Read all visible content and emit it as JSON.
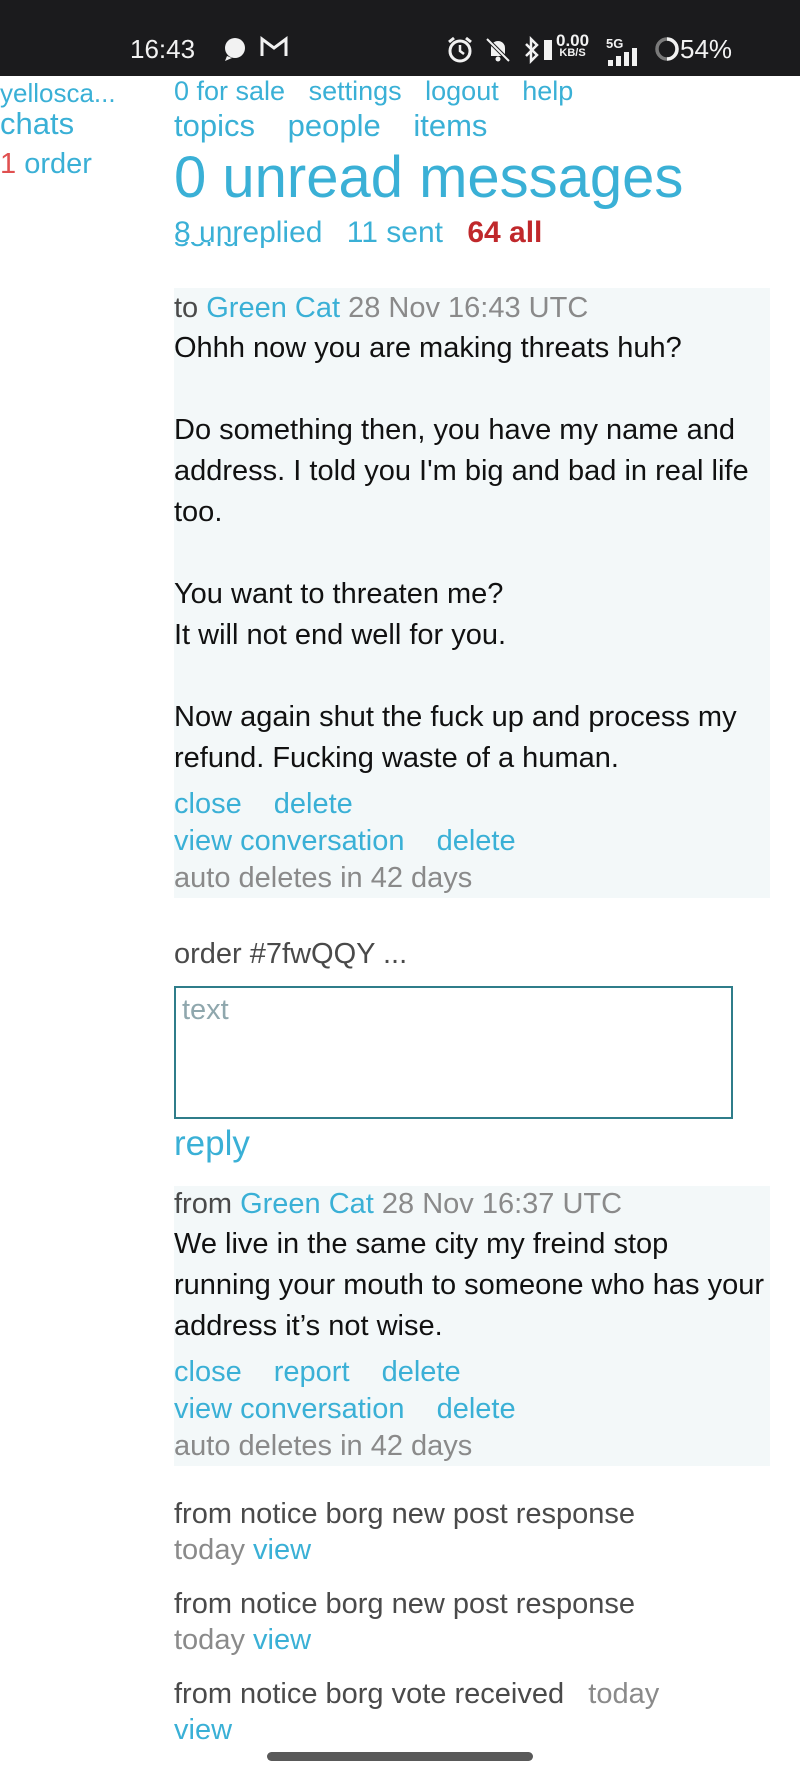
{
  "status_bar": {
    "time": "16:43",
    "data_rate": "0.00",
    "data_unit": "KB/S",
    "network": "5G",
    "battery": "54%",
    "icons": [
      "chat-bubble-icon",
      "gmail-icon",
      "alarm-icon",
      "mute-icon",
      "bluetooth-icon",
      "signal-icon",
      "battery-ring-icon"
    ]
  },
  "sidebar": {
    "username": "yellosca...",
    "chats": "chats",
    "order_count": "1",
    "order_label": "order"
  },
  "top_nav": [
    "0 for sale",
    "settings",
    "logout",
    "help"
  ],
  "main_nav": [
    "topics",
    "people",
    "items"
  ],
  "page_title": "0 unread messages",
  "filters": {
    "unreplied": "8 unreplied",
    "sent": "11 sent",
    "all": "64 all"
  },
  "cutoff_text": "send",
  "messages": [
    {
      "direction": "to",
      "user": "Green Cat",
      "timestamp": "28 Nov 16:43 UTC",
      "body": "Ohhh now you are making threats huh?\n\nDo something then, you have my name and address. I told you I'm big and bad in real life too.\n\nYou want to threaten me?\nIt will not end well for you.\n\nNow again shut the fuck up and process my refund. Fucking waste of a human.",
      "actions_row1": [
        "close",
        "delete"
      ],
      "actions_row2": [
        "view conversation",
        "delete"
      ],
      "auto_delete": "auto deletes in 42 days"
    },
    {
      "direction": "from",
      "user": "Green Cat",
      "timestamp": "28 Nov 16:37 UTC",
      "body": "We live in the same city my freind stop running your mouth to someone who has your address it’s not wise.",
      "actions_row1": [
        "close",
        "report",
        "delete"
      ],
      "actions_row2": [
        "view conversation",
        "delete"
      ],
      "auto_delete": "auto deletes in 42 days"
    }
  ],
  "reply": {
    "order_label": "order #7fwQQY ...",
    "placeholder": "text",
    "button": "reply"
  },
  "notices": [
    {
      "text": "from notice borg new post response",
      "when": "today",
      "link": "view"
    },
    {
      "text": "from notice borg new post response",
      "when": "today",
      "link": "view"
    },
    {
      "text": "from notice borg vote received",
      "when": "today",
      "link": "view"
    }
  ]
}
